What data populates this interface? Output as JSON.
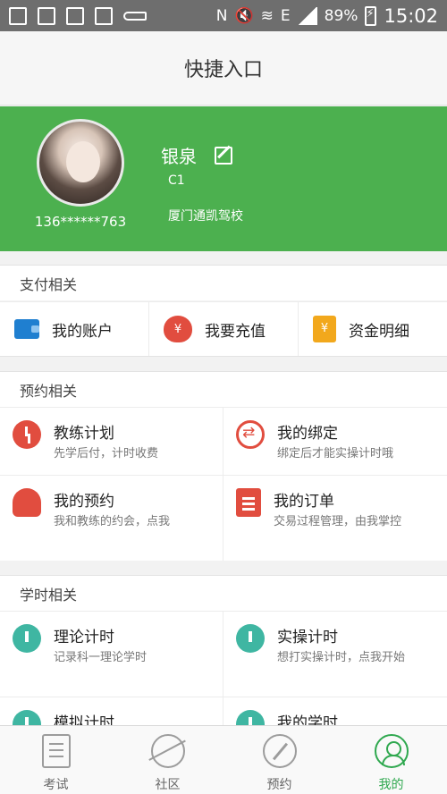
{
  "status_bar": {
    "battery": "89%",
    "time": "15:02",
    "network_label": "E"
  },
  "title": "快捷入口",
  "profile": {
    "name": "银泉",
    "phone": "136******763",
    "license": "C1",
    "school": "厦门通凯驾校"
  },
  "sections": {
    "payment": {
      "title": "支付相关",
      "items": [
        {
          "label": "我的账户",
          "icon": "wallet-icon"
        },
        {
          "label": "我要充值",
          "icon": "moneybag-icon",
          "glyph": "¥"
        },
        {
          "label": "资金明细",
          "icon": "coins-icon",
          "glyph": "¥"
        }
      ]
    },
    "booking": {
      "title": "预约相关",
      "items": [
        {
          "title": "教练计划",
          "subtitle": "先学后付，计时收费",
          "icon": "clock-icon"
        },
        {
          "title": "我的绑定",
          "subtitle": "绑定后才能实操计时哦",
          "icon": "exchange-icon"
        },
        {
          "title": "我的预约",
          "subtitle": "我和教练的约会，点我",
          "icon": "person-icon"
        },
        {
          "title": "我的订单",
          "subtitle": "交易过程管理，由我掌控",
          "icon": "clipboard-icon"
        }
      ]
    },
    "hours": {
      "title": "学时相关",
      "items": [
        {
          "title": "理论计时",
          "subtitle": "记录科一理论学时",
          "icon": "stopwatch-icon"
        },
        {
          "title": "实操计时",
          "subtitle": "想打实操计时，点我开始",
          "icon": "stopwatch-icon"
        },
        {
          "title": "模拟计时",
          "subtitle": "",
          "icon": "stopwatch-icon"
        },
        {
          "title": "我的学时",
          "subtitle": "",
          "icon": "stopwatch-icon"
        }
      ]
    }
  },
  "tabs": [
    {
      "label": "考试",
      "icon": "exam-icon",
      "active": false
    },
    {
      "label": "社区",
      "icon": "planet-icon",
      "active": false
    },
    {
      "label": "预约",
      "icon": "compass-icon",
      "active": false
    },
    {
      "label": "我的",
      "icon": "user-icon",
      "active": true
    }
  ],
  "colors": {
    "green": "#4cb04f",
    "tab_active": "#2fa84f",
    "red": "#e14d3f",
    "teal": "#3fb6a2",
    "blue": "#1f7fd0",
    "orange": "#f2a81c"
  }
}
